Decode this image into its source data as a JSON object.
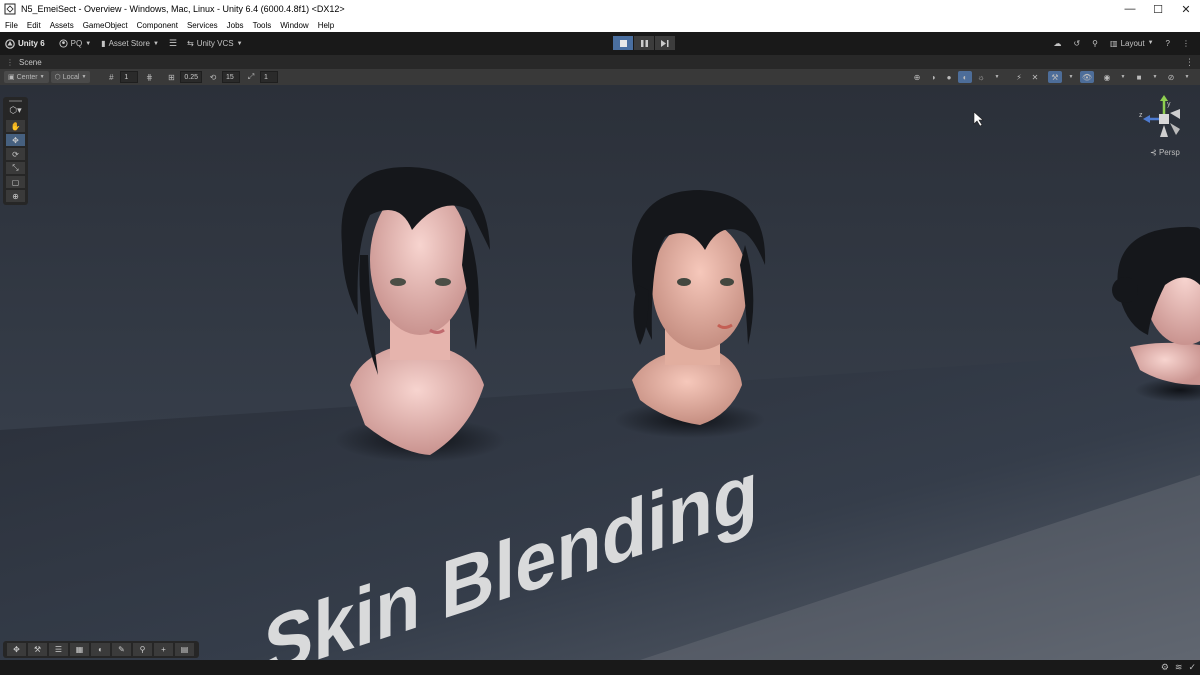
{
  "window": {
    "title": "N5_EmeiSect - Overview - Windows, Mac, Linux - Unity 6.4 (6000.4.8f1) <DX12>",
    "minimize": "—",
    "maximize": "☐",
    "close": "✕"
  },
  "menu": [
    "File",
    "Edit",
    "Assets",
    "GameObject",
    "Component",
    "Services",
    "Jobs",
    "Tools",
    "Window",
    "Help"
  ],
  "toolbar": {
    "unity_label": "Unity 6",
    "account_label": "PQ",
    "asset_store_label": "Asset Store",
    "vcs_label": "Unity VCS",
    "layout_label": "Layout"
  },
  "scene_tab": {
    "label": "Scene",
    "menu_icon": "⋮"
  },
  "scene_toolbar": {
    "pivot_label": "Center",
    "space_label": "Local",
    "grid_size": "1",
    "snap_increment": "0.25",
    "rotate_snap": "15",
    "scale_snap": "1"
  },
  "viewport": {
    "persp_label": "Persp",
    "floor_text": "Skin Blending",
    "gizmo_axes": {
      "y": "y",
      "z": "z"
    }
  },
  "colors": {
    "accent": "#4d6d99",
    "wall": "#323a46",
    "floor": "#2f3642"
  }
}
